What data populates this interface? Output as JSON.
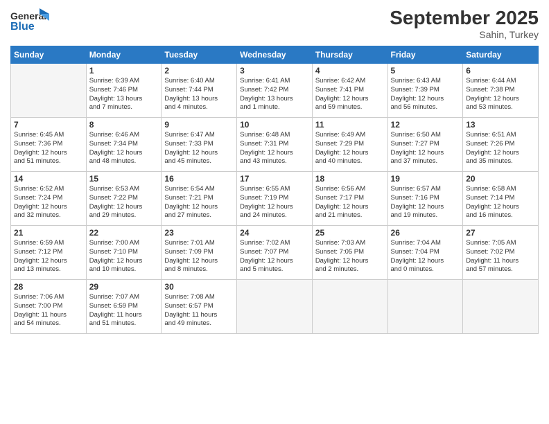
{
  "logo": {
    "line1": "General",
    "line2": "Blue"
  },
  "title": "September 2025",
  "subtitle": "Sahin, Turkey",
  "headers": [
    "Sunday",
    "Monday",
    "Tuesday",
    "Wednesday",
    "Thursday",
    "Friday",
    "Saturday"
  ],
  "weeks": [
    [
      {
        "day": "",
        "info": ""
      },
      {
        "day": "1",
        "info": "Sunrise: 6:39 AM\nSunset: 7:46 PM\nDaylight: 13 hours\nand 7 minutes."
      },
      {
        "day": "2",
        "info": "Sunrise: 6:40 AM\nSunset: 7:44 PM\nDaylight: 13 hours\nand 4 minutes."
      },
      {
        "day": "3",
        "info": "Sunrise: 6:41 AM\nSunset: 7:42 PM\nDaylight: 13 hours\nand 1 minute."
      },
      {
        "day": "4",
        "info": "Sunrise: 6:42 AM\nSunset: 7:41 PM\nDaylight: 12 hours\nand 59 minutes."
      },
      {
        "day": "5",
        "info": "Sunrise: 6:43 AM\nSunset: 7:39 PM\nDaylight: 12 hours\nand 56 minutes."
      },
      {
        "day": "6",
        "info": "Sunrise: 6:44 AM\nSunset: 7:38 PM\nDaylight: 12 hours\nand 53 minutes."
      }
    ],
    [
      {
        "day": "7",
        "info": "Sunrise: 6:45 AM\nSunset: 7:36 PM\nDaylight: 12 hours\nand 51 minutes."
      },
      {
        "day": "8",
        "info": "Sunrise: 6:46 AM\nSunset: 7:34 PM\nDaylight: 12 hours\nand 48 minutes."
      },
      {
        "day": "9",
        "info": "Sunrise: 6:47 AM\nSunset: 7:33 PM\nDaylight: 12 hours\nand 45 minutes."
      },
      {
        "day": "10",
        "info": "Sunrise: 6:48 AM\nSunset: 7:31 PM\nDaylight: 12 hours\nand 43 minutes."
      },
      {
        "day": "11",
        "info": "Sunrise: 6:49 AM\nSunset: 7:29 PM\nDaylight: 12 hours\nand 40 minutes."
      },
      {
        "day": "12",
        "info": "Sunrise: 6:50 AM\nSunset: 7:27 PM\nDaylight: 12 hours\nand 37 minutes."
      },
      {
        "day": "13",
        "info": "Sunrise: 6:51 AM\nSunset: 7:26 PM\nDaylight: 12 hours\nand 35 minutes."
      }
    ],
    [
      {
        "day": "14",
        "info": "Sunrise: 6:52 AM\nSunset: 7:24 PM\nDaylight: 12 hours\nand 32 minutes."
      },
      {
        "day": "15",
        "info": "Sunrise: 6:53 AM\nSunset: 7:22 PM\nDaylight: 12 hours\nand 29 minutes."
      },
      {
        "day": "16",
        "info": "Sunrise: 6:54 AM\nSunset: 7:21 PM\nDaylight: 12 hours\nand 27 minutes."
      },
      {
        "day": "17",
        "info": "Sunrise: 6:55 AM\nSunset: 7:19 PM\nDaylight: 12 hours\nand 24 minutes."
      },
      {
        "day": "18",
        "info": "Sunrise: 6:56 AM\nSunset: 7:17 PM\nDaylight: 12 hours\nand 21 minutes."
      },
      {
        "day": "19",
        "info": "Sunrise: 6:57 AM\nSunset: 7:16 PM\nDaylight: 12 hours\nand 19 minutes."
      },
      {
        "day": "20",
        "info": "Sunrise: 6:58 AM\nSunset: 7:14 PM\nDaylight: 12 hours\nand 16 minutes."
      }
    ],
    [
      {
        "day": "21",
        "info": "Sunrise: 6:59 AM\nSunset: 7:12 PM\nDaylight: 12 hours\nand 13 minutes."
      },
      {
        "day": "22",
        "info": "Sunrise: 7:00 AM\nSunset: 7:10 PM\nDaylight: 12 hours\nand 10 minutes."
      },
      {
        "day": "23",
        "info": "Sunrise: 7:01 AM\nSunset: 7:09 PM\nDaylight: 12 hours\nand 8 minutes."
      },
      {
        "day": "24",
        "info": "Sunrise: 7:02 AM\nSunset: 7:07 PM\nDaylight: 12 hours\nand 5 minutes."
      },
      {
        "day": "25",
        "info": "Sunrise: 7:03 AM\nSunset: 7:05 PM\nDaylight: 12 hours\nand 2 minutes."
      },
      {
        "day": "26",
        "info": "Sunrise: 7:04 AM\nSunset: 7:04 PM\nDaylight: 12 hours\nand 0 minutes."
      },
      {
        "day": "27",
        "info": "Sunrise: 7:05 AM\nSunset: 7:02 PM\nDaylight: 11 hours\nand 57 minutes."
      }
    ],
    [
      {
        "day": "28",
        "info": "Sunrise: 7:06 AM\nSunset: 7:00 PM\nDaylight: 11 hours\nand 54 minutes."
      },
      {
        "day": "29",
        "info": "Sunrise: 7:07 AM\nSunset: 6:59 PM\nDaylight: 11 hours\nand 51 minutes."
      },
      {
        "day": "30",
        "info": "Sunrise: 7:08 AM\nSunset: 6:57 PM\nDaylight: 11 hours\nand 49 minutes."
      },
      {
        "day": "",
        "info": ""
      },
      {
        "day": "",
        "info": ""
      },
      {
        "day": "",
        "info": ""
      },
      {
        "day": "",
        "info": ""
      }
    ]
  ]
}
